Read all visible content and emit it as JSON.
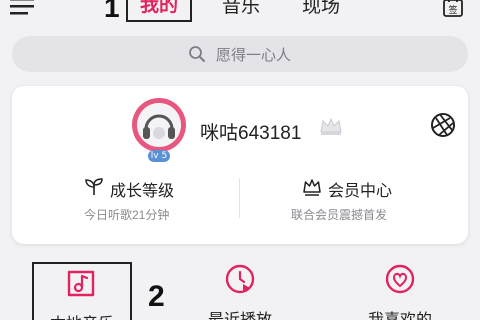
{
  "colors": {
    "accent": "#e0245e",
    "background": "#f2f2f4",
    "card": "#ffffff",
    "muted_text": "#8a8a90",
    "level_badge": "#5b8fd6"
  },
  "header": {
    "menu_icon": "menu-icon",
    "annotation_marker": "1",
    "tabs": [
      {
        "label": "我的",
        "active": true
      },
      {
        "label": "音乐",
        "active": false
      },
      {
        "label": "现场",
        "active": false
      }
    ],
    "sign_icon": "sign-in-icon",
    "sign_label": "签"
  },
  "search": {
    "icon": "search-icon",
    "placeholder": "愿得一心人"
  },
  "profile": {
    "avatar_icon": "headphones-avatar-icon",
    "level": "lv 5",
    "username": "咪咕643181",
    "crown_icon": "crown-icon",
    "settings_icon": "aperture-icon",
    "stats": [
      {
        "icon": "sprout-icon",
        "label": "成长等级",
        "sub": "今日听歌21分钟"
      },
      {
        "icon": "crown-outline-icon",
        "label": "会员中心",
        "sub": "联合会员震撼首发"
      }
    ]
  },
  "shortcuts": {
    "annotation_marker": "2",
    "items": [
      {
        "icon": "local-music-icon",
        "label": "本地音乐"
      },
      {
        "icon": "recent-play-icon",
        "label": "最近播放"
      },
      {
        "icon": "heart-icon",
        "label": "我喜欢的"
      }
    ]
  }
}
